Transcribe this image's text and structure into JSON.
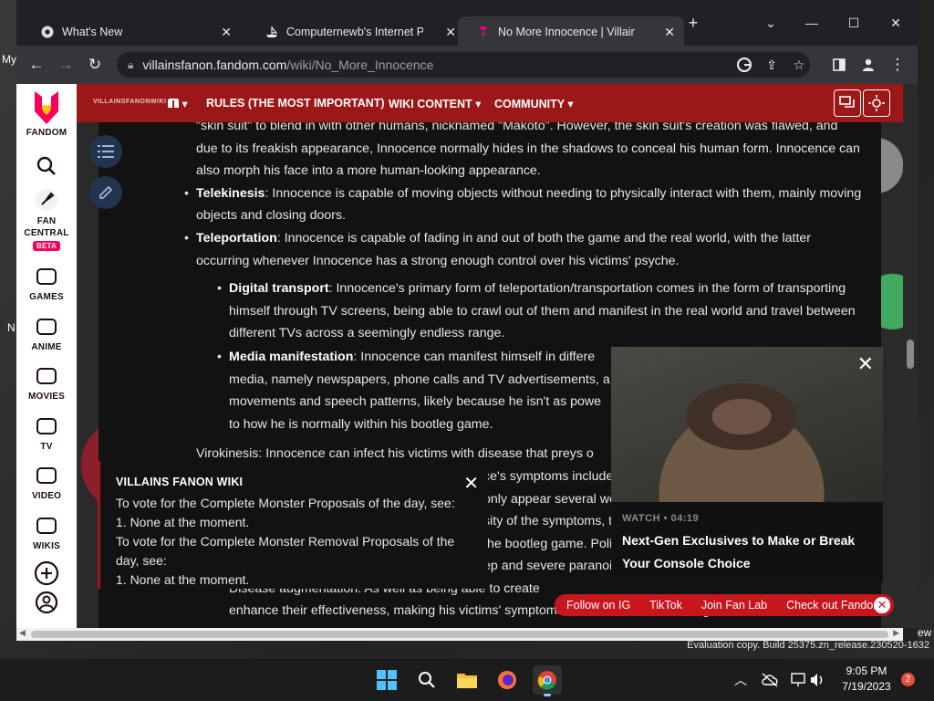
{
  "desktop": {
    "left_labels": [
      "My",
      "N"
    ],
    "right_label": "ew",
    "watermark_line1": "Evaluation copy. Build 25375.zn_release.230520-1632"
  },
  "browser": {
    "tabs": [
      {
        "title": "What's New",
        "favicon": "chrome-icon"
      },
      {
        "title": "Computernewb's Internet Pub H",
        "favicon": "ship-icon"
      },
      {
        "title": "No More Innocence | Villains Fan",
        "favicon": "fandom-icon"
      }
    ],
    "url_host": "villainsfanon.fandom.com",
    "url_path": "/wiki/No_More_Innocence"
  },
  "fandom_rail": {
    "items": [
      {
        "label": "FANDOM"
      },
      {
        "label": "FAN CENTRAL",
        "badge": "BETA"
      },
      {
        "label": "GAMES"
      },
      {
        "label": "ANIME"
      },
      {
        "label": "MOVIES"
      },
      {
        "label": "TV"
      },
      {
        "label": "VIDEO"
      },
      {
        "label": "WIKIS"
      }
    ]
  },
  "wiki_header": {
    "logo_text": "VILLAINSFANONWIKI",
    "nav": [
      "RULES (THE MOST IMPORTANT)",
      "WIKI CONTENT",
      "COMMUNITY"
    ]
  },
  "article": {
    "p0": "\"skin suit\" to blend in with other humans, nicknamed \"Makoto\". However, the skin suit's creation was flawed, and due to its freakish appearance, Innocence normally hides in the shadows to conceal his human form. Innocence can also morph his face into a more human-looking appearance.",
    "telekinesis_term": "Telekinesis",
    "telekinesis_text": ": Innocence is capable of moving objects without needing to physically interact with them, mainly moving objects and closing doors.",
    "teleportation_term": "Teleportation",
    "teleportation_text": ": Innocence is capable of fading in and out of both the game and the real world, with the latter occurring whenever Innocence has a strong enough control over his victims' psyche.",
    "digital_term": "Digital transport",
    "digital_text": ": Innocence's primary form of teleportation/transportation comes in the form of transporting himself through TV screens, being able to crawl out of them and manifest in the real world and travel between different TVs across a seemingly endless range.",
    "media_term": "Media manifestation",
    "media_text": ": Innocence can manifest himself in differe... media, namely newspapers, phone calls and TV advertisements, a... movements and speech patterns, likely because he isn't as powe... to how he is normally within his bootleg game.",
    "media_lines": [
      ": Innocence can manifest himself in differe",
      "media, namely newspapers, phone calls and TV advertisements, a",
      "movements and speech patterns, likely because he isn't as powe",
      "to how he is normally within his bootleg game."
    ],
    "hidden_lines": [
      "Virokinesis: Innocence can infect his victims with disease that preys o",
      "ce's symptoms include",
      "only appear several wee",
      "sity of the symptoms, th",
      "the bootleg game. Polic",
      "ep and severe paranoia",
      "Disease augmentation: As well as being able to create",
      "enhance their effectiveness, making his victims' symptoms more severe and leading to their mental"
    ]
  },
  "notice": {
    "title": "VILLAINS FANON WIKI",
    "lines": [
      "To vote for the Complete Monster Proposals of the day, see:",
      "1. None at the moment.",
      "To vote for the Complete Monster Removal Proposals of the",
      "day, see:",
      "1. None at the moment."
    ]
  },
  "video_ad": {
    "meta": "WATCH • 04:19",
    "headline": "Next-Gen Exclusives to Make or Break Your Console Choice"
  },
  "follow_bar": {
    "items": [
      "Follow on IG",
      "TikTok",
      "Join Fan Lab",
      "Check out Fandom"
    ]
  },
  "system_tray": {
    "time": "9:05 PM",
    "date": "7/19/2023",
    "notification_count": "2"
  }
}
